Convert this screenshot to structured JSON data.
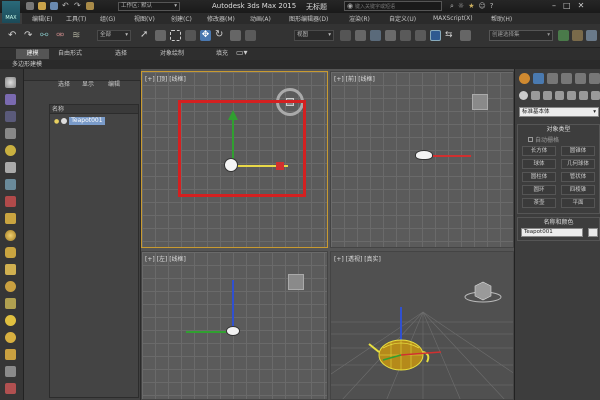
{
  "title_bar": {
    "app_logo": "MAX",
    "workspace_label": "工作区: 默认",
    "app_title": "Autodesk 3ds Max  2015",
    "doc_title": "无标题",
    "search_placeholder": "键入关键字或短语"
  },
  "menu": {
    "items": [
      "编辑(E)",
      "工具(T)",
      "组(G)",
      "视图(V)",
      "创建(C)",
      "修改器(M)",
      "动画(A)",
      "图形编辑器(D)",
      "渲染(R)",
      "自定义(U)",
      "MAXScript(X)",
      "帮助(H)"
    ]
  },
  "toolbar": {
    "filter_value": "全部",
    "view_value": "视图",
    "named_selection_placeholder": "创建选择集"
  },
  "ribbon": {
    "tabs": [
      "建模",
      "自由形式",
      "选择",
      "对象绘制",
      "填充"
    ],
    "subtab": "多边形建模"
  },
  "scene_explorer": {
    "tabs": [
      "选择",
      "显示",
      "编辑"
    ],
    "column_name": "名称",
    "items": [
      "Teapot001"
    ]
  },
  "viewports": {
    "top": "[+] [顶] [线框]",
    "front": "[+] [前] [线框]",
    "left": "[+] [左] [线框]",
    "perspective": "[+] [透视] [真实]"
  },
  "command_panel": {
    "category_value": "标准基本体",
    "section_object_type": "对象类型",
    "autogrid_label": "自动栅格",
    "object_buttons": [
      "长方体",
      "圆锥体",
      "球体",
      "几何球体",
      "圆柱体",
      "管状体",
      "圆环",
      "四棱锥",
      "茶壶",
      "平面"
    ],
    "section_name_color": "名称和颜色",
    "name_value": "Teapot001"
  },
  "colors": {
    "highlight_box": "#d42020",
    "x_axis": "#d03030",
    "y_axis": "#30a030",
    "z_axis": "#3050d0",
    "selected_wire": "#e8e040"
  }
}
